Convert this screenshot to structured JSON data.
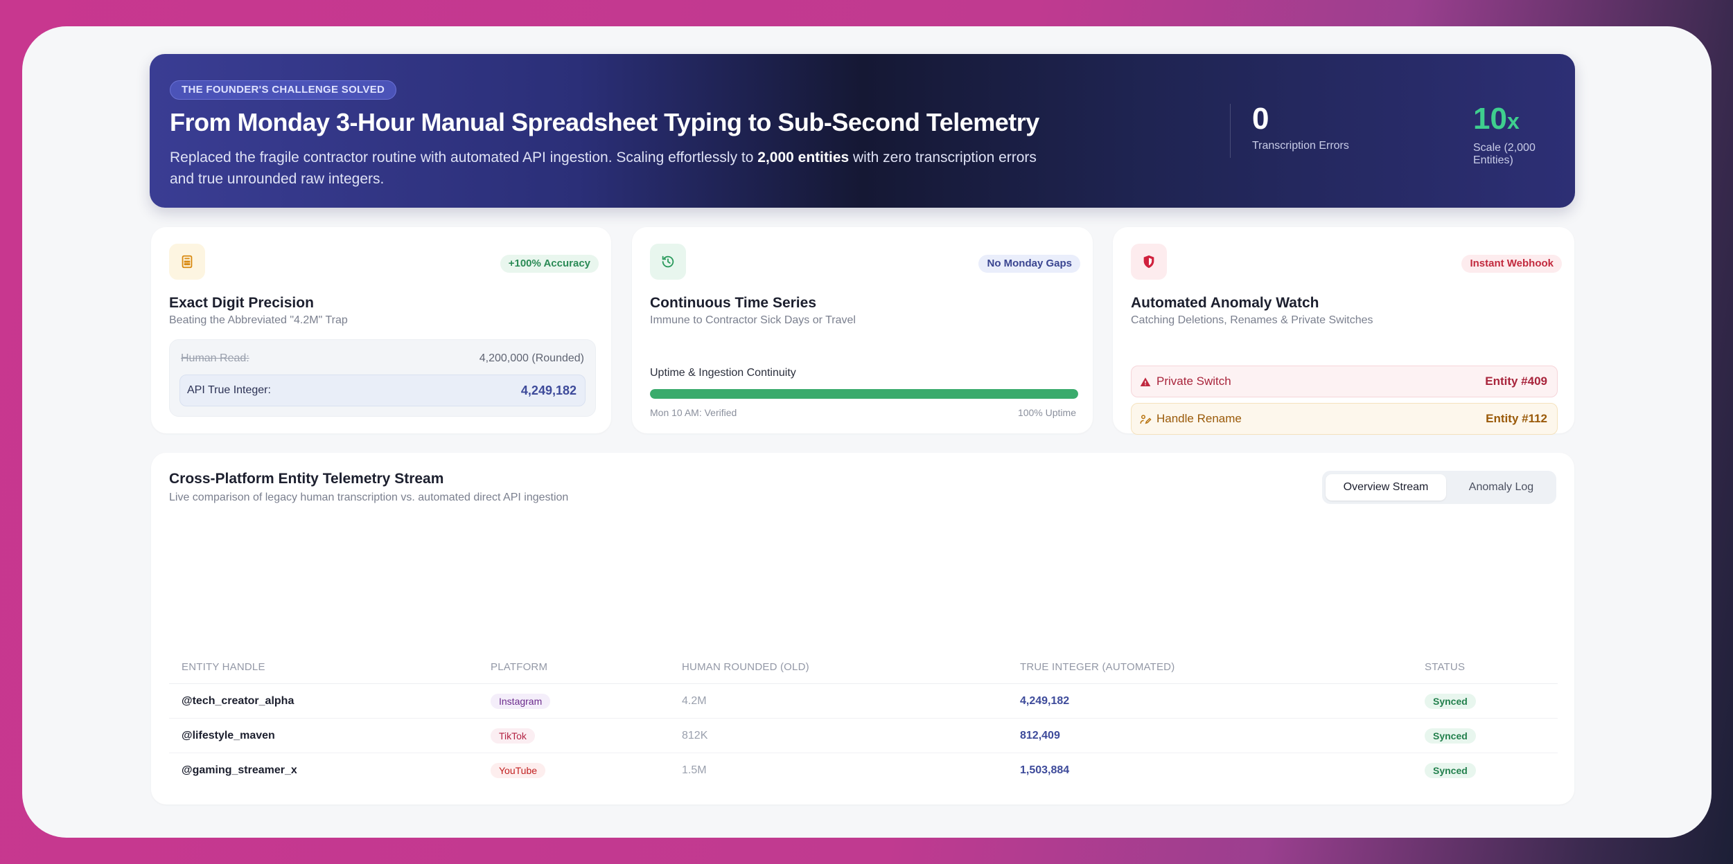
{
  "hero": {
    "pill": "THE FOUNDER'S CHALLENGE SOLVED",
    "title": "From Monday 3-Hour Manual Spreadsheet Typing to Sub-Second Telemetry",
    "desc_before": "Replaced the fragile contractor routine with automated API ingestion. Scaling effortlessly to ",
    "desc_bold": "2,000 entities",
    "desc_after": " with zero transcription errors and true unrounded raw integers.",
    "stats": [
      {
        "value": "0",
        "suffix": "",
        "label": "Transcription Errors"
      },
      {
        "value": "10",
        "suffix": "x",
        "label": "Scale (2,000 Entities)"
      }
    ]
  },
  "cards": {
    "precision": {
      "icon": "calculator-icon",
      "badge": "+100% Accuracy",
      "title": "Exact Digit Precision",
      "subtitle": "Beating the Abbreviated \"4.2M\" Trap",
      "human_label": "Human Read:",
      "human_value": "4,200,000 (Rounded)",
      "api_label": "API True Integer:",
      "api_value": "4,249,182"
    },
    "timeseries": {
      "icon": "history-icon",
      "badge": "No Monday Gaps",
      "title": "Continuous Time Series",
      "subtitle": "Immune to Contractor Sick Days or Travel",
      "bar_label": "Uptime & Ingestion Continuity",
      "progress_percent": 100,
      "left_caption": "Mon 10 AM: Verified",
      "right_caption": "100% Uptime"
    },
    "anomaly": {
      "icon": "shield-icon",
      "badge": "Instant Webhook",
      "title": "Automated Anomaly Watch",
      "subtitle": "Catching Deletions, Renames & Private Switches",
      "alerts": [
        {
          "icon": "warning-icon",
          "label": "Private Switch",
          "entity": "Entity #409"
        },
        {
          "icon": "rename-icon",
          "label": "Handle Rename",
          "entity": "Entity #112"
        }
      ]
    }
  },
  "stream": {
    "title": "Cross-Platform Entity Telemetry Stream",
    "subtitle": "Live comparison of legacy human transcription vs. automated direct API ingestion",
    "tabs": [
      "Overview Stream",
      "Anomaly Log"
    ],
    "active_tab": "Overview Stream",
    "columns": [
      "ENTITY HANDLE",
      "PLATFORM",
      "HUMAN ROUNDED (OLD)",
      "TRUE INTEGER (AUTOMATED)",
      "STATUS"
    ],
    "rows": [
      {
        "handle": "@tech_creator_alpha",
        "platform": "Instagram",
        "old": "4.2M",
        "true": "4,249,182",
        "status": "Synced"
      },
      {
        "handle": "@lifestyle_maven",
        "platform": "TikTok",
        "old": "812K",
        "true": "812,409",
        "status": "Synced"
      },
      {
        "handle": "@gaming_streamer_x",
        "platform": "YouTube",
        "old": "1.5M",
        "true": "1,503,884",
        "status": "Synced"
      }
    ]
  },
  "colors": {
    "accent_green": "#3fcf8e",
    "progress_green": "#3aab6c",
    "true_value_blue": "#3d4a9a",
    "alert_red": "#a8243b",
    "alert_amber": "#9a5a09"
  }
}
